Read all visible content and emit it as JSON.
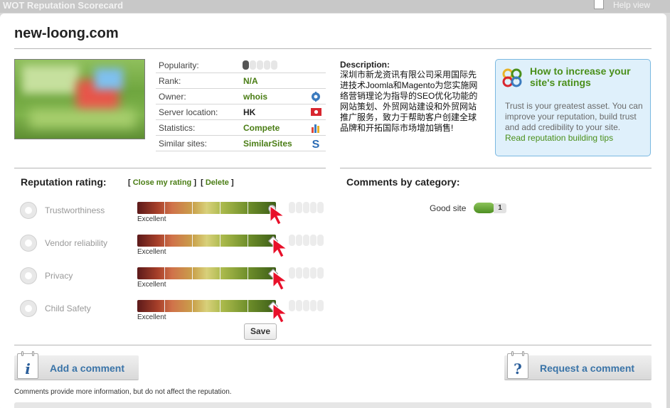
{
  "topbar": {
    "title": "WOT Reputation Scorecard",
    "help": "Help view"
  },
  "site": {
    "domain": "new-loong.com"
  },
  "info": [
    {
      "label": "Popularity:",
      "value": "",
      "popularity_level": 1,
      "popularity_max": 5
    },
    {
      "label": "Rank:",
      "value": "N/A"
    },
    {
      "label": "Owner:",
      "value": "whois",
      "icon": "gear-icon"
    },
    {
      "label": "Server location:",
      "value": "HK",
      "icon": "hk-flag-icon"
    },
    {
      "label": "Statistics:",
      "value": "Compete",
      "icon": "statistics-icon"
    },
    {
      "label": "Similar sites:",
      "value": "SimilarSites",
      "icon": "similarsites-icon"
    }
  ],
  "description": {
    "title": "Description:",
    "text": "深圳市新龙资讯有限公司采用国际先进技术Joomla和Magento为您实施网络营销理论为指导的SEO优化功能的网站策划、外贸网站建设和外贸网站推广服务，致力于帮助客户创建全球品牌和开拓国际市场增加销售!"
  },
  "tip": {
    "title": "How to increase your site's ratings",
    "text": "Trust is your greatest asset. You can improve your reputation, build trust and add credibility to your site.",
    "link": "Read reputation building tips"
  },
  "reputation": {
    "title": "Reputation rating:",
    "close_label": "Close my rating",
    "delete_label": "Delete",
    "save_label": "Save",
    "rows": [
      {
        "name": "Trustworthiness",
        "level_label": "Excellent",
        "rating": 1.0
      },
      {
        "name": "Vendor reliability",
        "level_label": "Excellent",
        "rating": 1.0
      },
      {
        "name": "Privacy",
        "level_label": "Excellent",
        "rating": 1.0
      },
      {
        "name": "Child Safety",
        "level_label": "Excellent",
        "rating": 1.0
      }
    ]
  },
  "comments": {
    "title": "Comments by category:",
    "categories": [
      {
        "name": "Good site",
        "count": "1",
        "color": "#6aa83a"
      }
    ],
    "add_label": "Add a comment",
    "request_label": "Request a comment",
    "note": "Comments provide more information, but do not affect the reputation."
  },
  "colors": {
    "accent_green": "#4a7d14",
    "link_blue": "#3a74a8",
    "tip_bg": "#dff0fb",
    "tip_border": "#7ab8e0"
  }
}
